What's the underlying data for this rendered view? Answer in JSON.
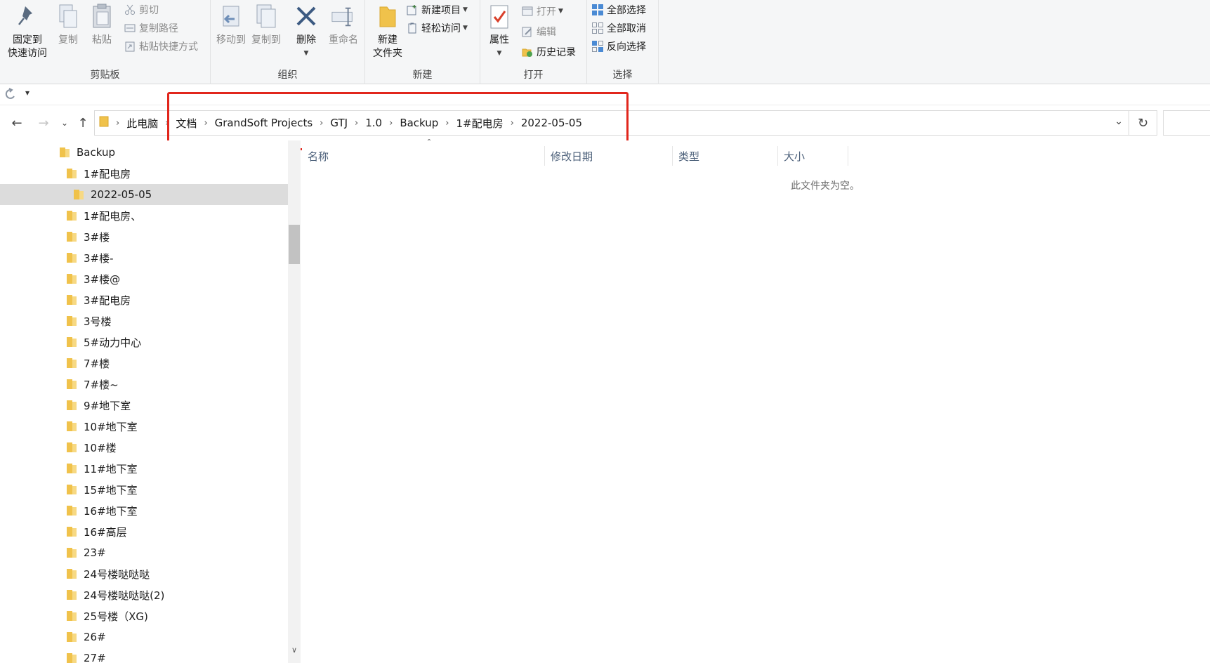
{
  "ribbon": {
    "clipboard": {
      "label": "剪贴板",
      "pin_line1": "固定到",
      "pin_line2": "快速访问",
      "copy": "复制",
      "paste": "粘贴",
      "cut": "剪切",
      "copy_path": "复制路径",
      "paste_shortcut": "粘贴快捷方式"
    },
    "organize": {
      "label": "组织",
      "move_to": "移动到",
      "copy_to": "复制到",
      "delete": "删除",
      "rename": "重命名"
    },
    "new": {
      "label": "新建",
      "new_folder_line1": "新建",
      "new_folder_line2": "文件夹",
      "new_item": "新建项目",
      "easy_access": "轻松访问"
    },
    "open": {
      "label": "打开",
      "properties": "属性",
      "open": "打开",
      "edit": "编辑",
      "history": "历史记录"
    },
    "select": {
      "label": "选择",
      "select_all": "全部选择",
      "select_none": "全部取消",
      "invert": "反向选择"
    }
  },
  "address": {
    "crumbs": [
      "此电脑",
      "文档",
      "GrandSoft Projects",
      "GTJ",
      "1.0",
      "Backup",
      "1#配电房",
      "2022-05-05"
    ]
  },
  "tree": {
    "items": [
      {
        "label": "Backup",
        "level": 0
      },
      {
        "label": "1#配电房",
        "level": 1
      },
      {
        "label": "2022-05-05",
        "level": 2,
        "selected": true
      },
      {
        "label": "1#配电房、",
        "level": 1
      },
      {
        "label": "3#楼",
        "level": 1
      },
      {
        "label": "3#楼-",
        "level": 1
      },
      {
        "label": "3#楼@",
        "level": 1
      },
      {
        "label": "3#配电房",
        "level": 1
      },
      {
        "label": "3号楼",
        "level": 1
      },
      {
        "label": "5#动力中心",
        "level": 1
      },
      {
        "label": "7#楼",
        "level": 1
      },
      {
        "label": "7#楼~",
        "level": 1
      },
      {
        "label": "9#地下室",
        "level": 1
      },
      {
        "label": "10#地下室",
        "level": 1
      },
      {
        "label": "10#楼",
        "level": 1
      },
      {
        "label": "11#地下室",
        "level": 1
      },
      {
        "label": "15#地下室",
        "level": 1
      },
      {
        "label": "16#地下室",
        "level": 1
      },
      {
        "label": "16#高层",
        "level": 1
      },
      {
        "label": "23#",
        "level": 1
      },
      {
        "label": "24号楼哒哒哒",
        "level": 1
      },
      {
        "label": "24号楼哒哒哒(2)",
        "level": 1
      },
      {
        "label": "25号楼（XG)",
        "level": 1
      },
      {
        "label": "26#",
        "level": 1
      },
      {
        "label": "27#",
        "level": 1
      }
    ]
  },
  "content": {
    "columns": {
      "name": "名称",
      "modified": "修改日期",
      "type": "类型",
      "size": "大小"
    },
    "empty_text": "此文件夹为空。"
  },
  "colors": {
    "folder": "#f0c24b",
    "highlight_box": "#e1261c",
    "selected_row": "#dcdcdc",
    "column_header": "#4c607a"
  }
}
